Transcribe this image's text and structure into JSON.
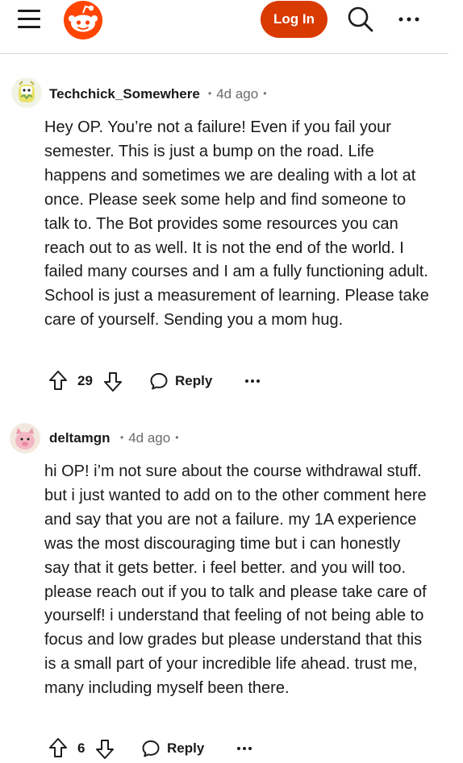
{
  "header": {
    "login_label": "Log In",
    "colors": {
      "brand": "#ff4500",
      "login_bg": "#d93a00"
    },
    "icons": [
      "menu-icon",
      "reddit-logo",
      "search-icon",
      "more-icon"
    ]
  },
  "comments": [
    {
      "username": "Techchick_Somewhere",
      "age": "4d ago",
      "body": "Hey OP. You’re not a failure! Even if you fail your semester. This is just a bump on the road. Life happens and sometimes we are dealing with a lot at once. Please seek some help and find someone to talk to. The Bot provides some resources you can reach out to as well. It is not the end of the world. I failed many courses and I am a fully functioning adult. School is just a measurement of learning. Please take care of yourself. Sending you a mom hug.",
      "votes": "29",
      "reply_label": "Reply"
    },
    {
      "username": "deltamgn",
      "age": "4d ago",
      "body": "hi OP! i’m not sure about the course withdrawal stuff. but i just wanted to add on to the other comment here and say that you are not a failure. my 1A experience was the most discouraging time but i can honestly say that it gets better. i feel better. and you will too. please reach out if you to talk and please take care of yourself! i understand that feeling of not being able to focus and low grades but please understand that this is a small part of your incredible life ahead. trust me, many including myself been there.",
      "votes": "6",
      "reply_label": "Reply"
    }
  ]
}
